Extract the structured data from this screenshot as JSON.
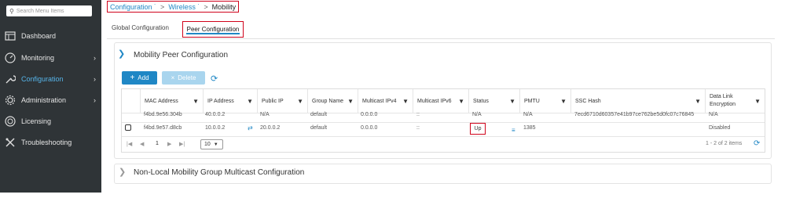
{
  "sidebar": {
    "search_placeholder": "Search Menu Items",
    "items": [
      {
        "label": "Dashboard",
        "icon": "dashboard-icon"
      },
      {
        "label": "Monitoring",
        "icon": "monitoring-icon"
      },
      {
        "label": "Configuration",
        "icon": "wrench-icon"
      },
      {
        "label": "Administration",
        "icon": "gear-icon"
      },
      {
        "label": "Licensing",
        "icon": "licensing-icon"
      },
      {
        "label": "Troubleshooting",
        "icon": "tools-icon"
      }
    ]
  },
  "breadcrumb": {
    "item1": "Configuration",
    "item2": "Wireless",
    "current": "Mobility",
    "sep": ">"
  },
  "tabs": {
    "global": "Global Configuration",
    "peer": "Peer Configuration"
  },
  "section": {
    "title": "Mobility Peer Configuration",
    "add_label": "Add",
    "delete_label": "Delete"
  },
  "table": {
    "columns": [
      "MAC Address",
      "IP Address",
      "Public IP",
      "Group Name",
      "Multicast IPv4",
      "Multicast IPv6",
      "Status",
      "PMTU",
      "SSC Hash",
      "Data Link Encryption"
    ],
    "rows": [
      {
        "mac": "f4bd.9e56.304b",
        "ip": "40.0.0.2",
        "public_ip": "N/A",
        "group": "default",
        "mcast4": "0.0.0.0",
        "mcast6": "::",
        "status": "N/A",
        "pmtu": "N/A",
        "hash": "7ecd6710d60357e41b97ce762be5d0fc07c76845",
        "encryption": "N/A"
      },
      {
        "mac": "f4bd.9e57.d8cb",
        "ip": "10.0.0.2",
        "public_ip": "20.0.0.2",
        "group": "default",
        "mcast4": "0.0.0.0",
        "mcast6": "::",
        "status": "Up",
        "pmtu": "1385",
        "hash": "",
        "encryption": "Disabled"
      }
    ]
  },
  "pager": {
    "page": "1",
    "page_size": "10",
    "summary": "1 - 2 of 2 items"
  },
  "section2": {
    "title": "Non-Local Mobility Group Multicast Configuration"
  },
  "colors": {
    "accent": "#1f87c5",
    "sidebar_bg": "#2f3437",
    "highlight_red": "#d0021b"
  }
}
